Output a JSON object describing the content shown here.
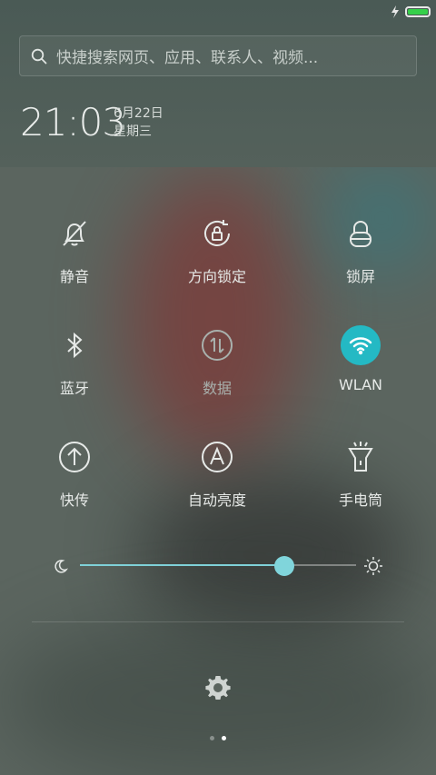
{
  "status_bar": {
    "battery_level": 1.0,
    "charging_icon": "bolt-icon"
  },
  "search": {
    "placeholder": "快捷搜索网页、应用、联系人、视频..."
  },
  "clock": {
    "time": "21:03",
    "date": "6月22日",
    "weekday": "星期三"
  },
  "toggles": [
    {
      "label": "静音",
      "icon": "bell-off-icon",
      "active": false
    },
    {
      "label": "方向锁定",
      "icon": "rotation-lock-icon",
      "active": false
    },
    {
      "label": "锁屏",
      "icon": "lock-icon",
      "active": false
    },
    {
      "label": "蓝牙",
      "icon": "bluetooth-icon",
      "active": false
    },
    {
      "label": "数据",
      "icon": "mobile-data-icon",
      "active": false,
      "disabled": true
    },
    {
      "label": "WLAN",
      "icon": "wifi-icon",
      "active": true
    },
    {
      "label": "快传",
      "icon": "share-upload-icon",
      "active": false
    },
    {
      "label": "自动亮度",
      "icon": "auto-brightness-icon",
      "active": false
    },
    {
      "label": "手电筒",
      "icon": "flashlight-icon",
      "active": false
    }
  ],
  "brightness": {
    "level": 0.74
  },
  "pager": {
    "pages": 2,
    "current": 2
  },
  "colors": {
    "accent": "#24b9c4",
    "battery": "#35d04a"
  }
}
